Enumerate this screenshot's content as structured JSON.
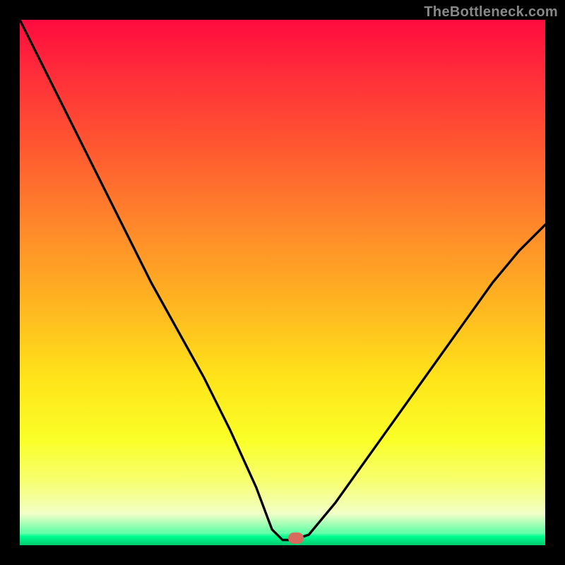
{
  "watermark": "TheBottleneck.com",
  "marker": {
    "x_pct": 52.5,
    "y_pct": 98.7
  },
  "chart_data": {
    "type": "line",
    "title": "",
    "xlabel": "",
    "ylabel": "",
    "xlim": [
      0,
      100
    ],
    "ylim": [
      0,
      100
    ],
    "series": [
      {
        "name": "bottleneck-curve",
        "x": [
          0,
          5,
          10,
          15,
          20,
          25,
          30,
          35,
          40,
          45,
          48,
          50,
          52,
          55,
          60,
          65,
          70,
          75,
          80,
          85,
          90,
          95,
          100
        ],
        "values": [
          100,
          90,
          80,
          70,
          60,
          50,
          41,
          32,
          22,
          11,
          3,
          1,
          1,
          2,
          8,
          15,
          22,
          29,
          36,
          43,
          50,
          56,
          61
        ]
      }
    ],
    "annotations": [
      {
        "type": "marker",
        "x": 52.5,
        "y": 1.3,
        "color": "#d86a5e"
      }
    ],
    "background_gradient": {
      "stops": [
        {
          "pct": 0,
          "color": "#ff0b3e"
        },
        {
          "pct": 25,
          "color": "#ff5a30"
        },
        {
          "pct": 55,
          "color": "#ffb820"
        },
        {
          "pct": 80,
          "color": "#faff28"
        },
        {
          "pct": 100,
          "color": "#00ff90"
        }
      ]
    }
  }
}
